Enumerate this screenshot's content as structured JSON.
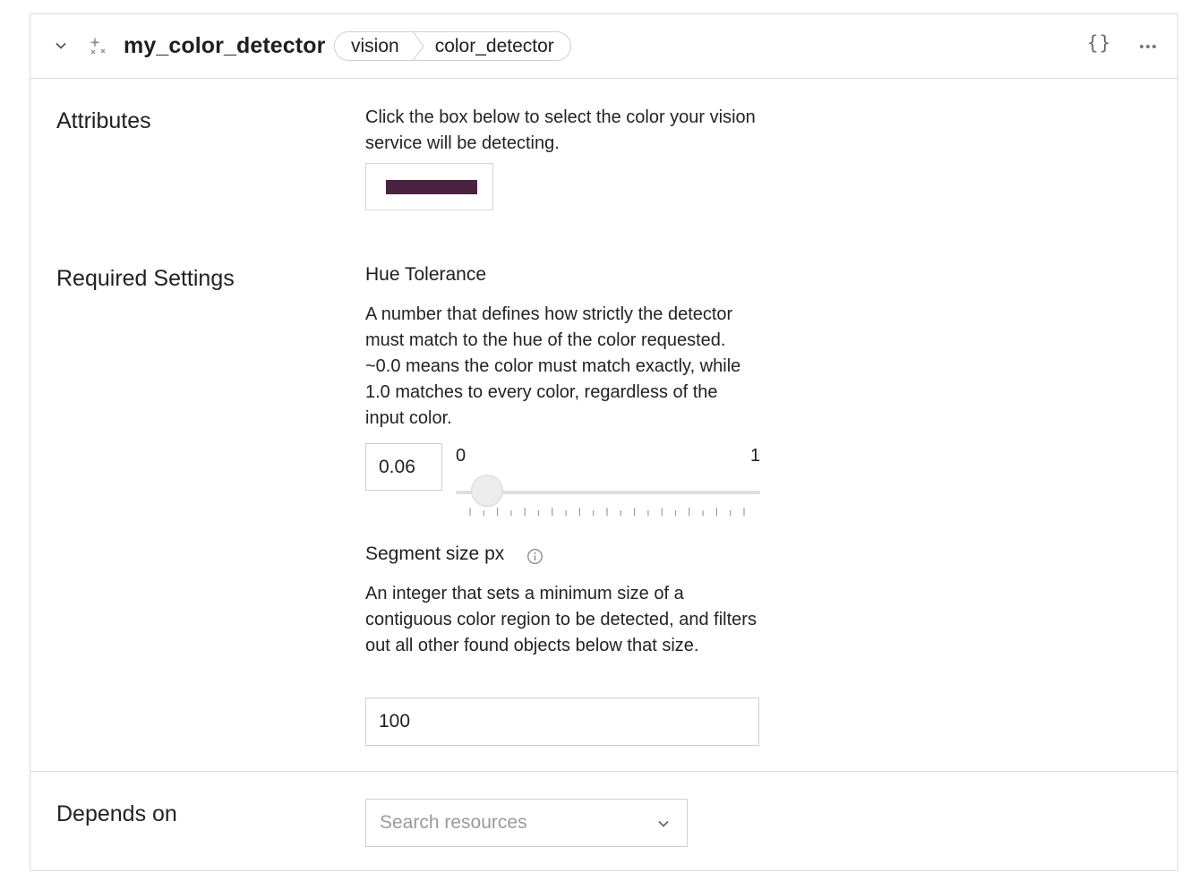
{
  "header": {
    "title": "my_color_detector",
    "breadcrumbs": [
      "vision",
      "color_detector"
    ],
    "json_button": "{}",
    "icons": {
      "collapse": "chevron-down-icon",
      "service": "sparkle-icon",
      "more": "more-horizontal-icon"
    }
  },
  "attributes": {
    "label": "Attributes",
    "description": "Click the box below to select the color your vision service will be detecting.",
    "color": "#4a2340"
  },
  "required": {
    "label": "Required Settings",
    "hue": {
      "label": "Hue Tolerance",
      "description": "A number that defines how strictly the detector must match to the hue of the color requested. ~0.0 means the color must match exactly, while 1.0 matches to every color, regardless of the input color.",
      "value": "0.06",
      "min": "0",
      "max": "1"
    },
    "segment": {
      "label": "Segment size px",
      "description": "An integer that sets a minimum size of a contiguous color region to be detected, and filters out all other found objects below that size.",
      "value": "100"
    }
  },
  "depends": {
    "label": "Depends on",
    "placeholder": "Search resources"
  }
}
